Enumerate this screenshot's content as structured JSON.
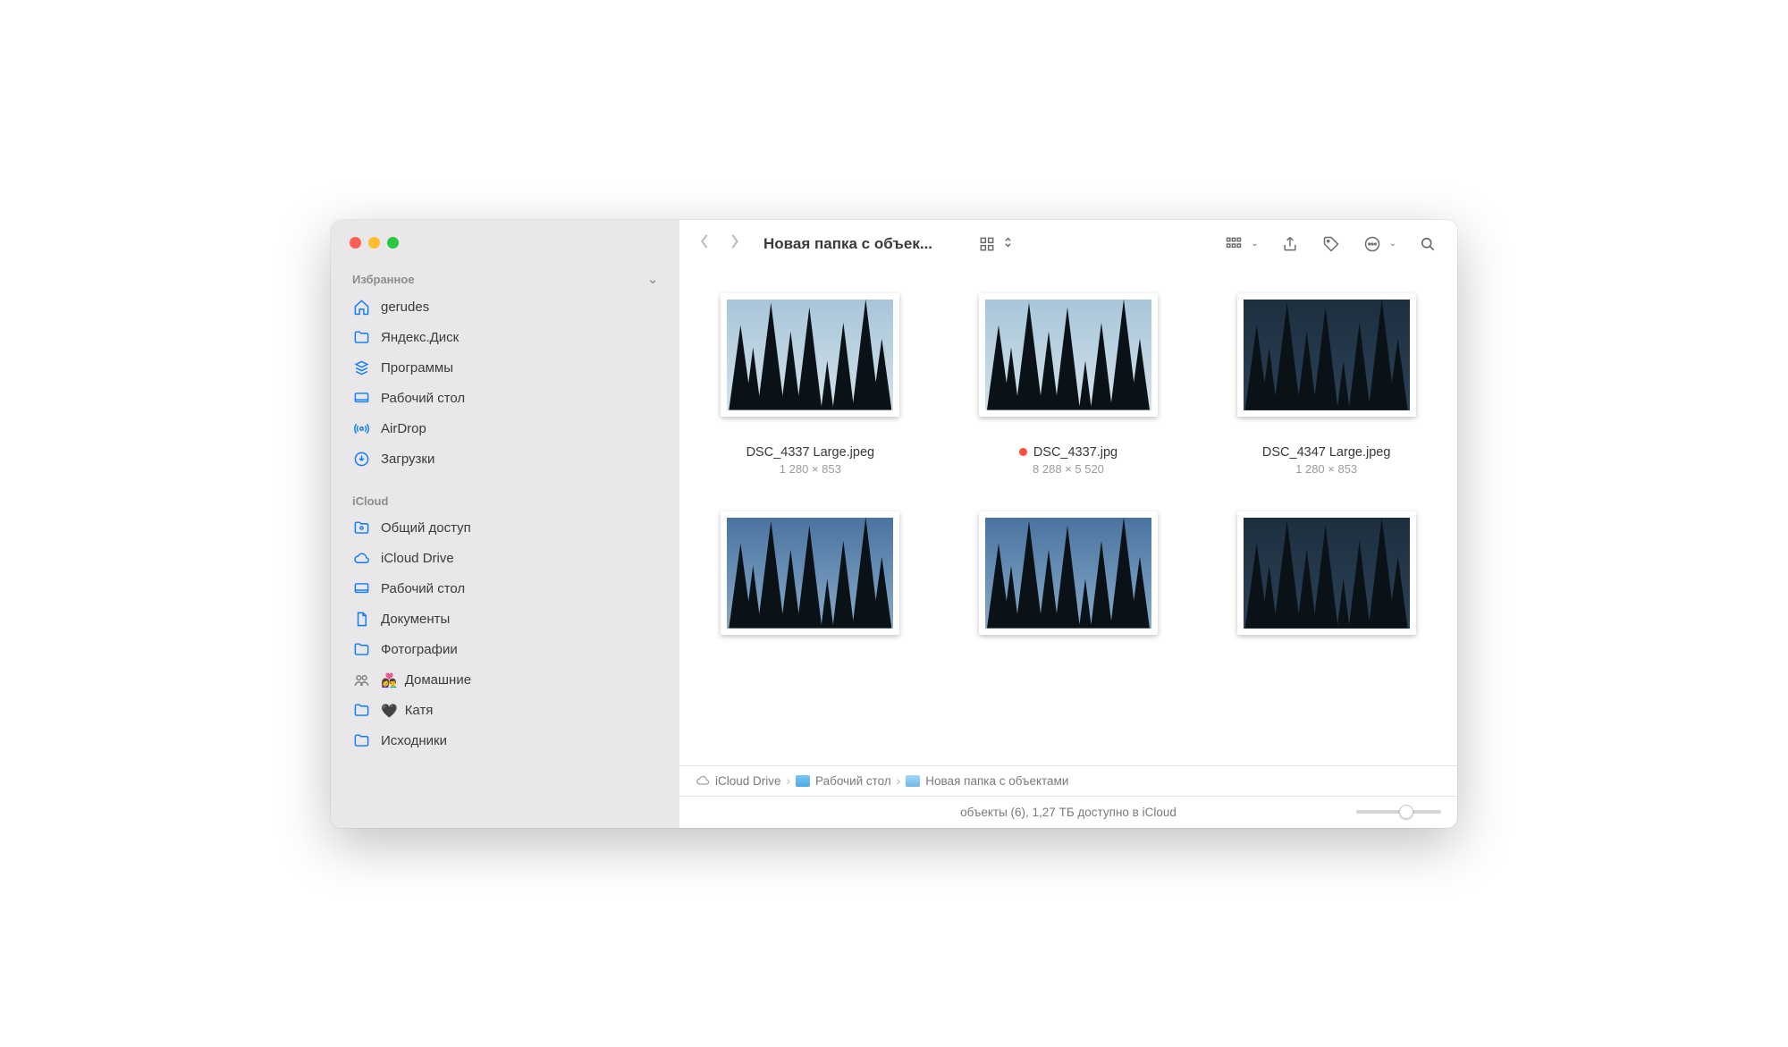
{
  "sidebar": {
    "section_favorites": "Избранное",
    "section_icloud": "iCloud",
    "favorites": [
      {
        "label": "gerudes",
        "icon": "home"
      },
      {
        "label": "Яндекс.Диск",
        "icon": "folder"
      },
      {
        "label": "Программы",
        "icon": "apps"
      },
      {
        "label": "Рабочий стол",
        "icon": "desktop"
      },
      {
        "label": "AirDrop",
        "icon": "airdrop"
      },
      {
        "label": "Загрузки",
        "icon": "download"
      }
    ],
    "icloud": [
      {
        "label": "Общий доступ",
        "icon": "shared"
      },
      {
        "label": "iCloud Drive",
        "icon": "cloud"
      },
      {
        "label": "Рабочий стол",
        "icon": "desktop"
      },
      {
        "label": "Документы",
        "icon": "doc"
      },
      {
        "label": "Фотографии",
        "icon": "folder"
      },
      {
        "label": "Домашние",
        "icon": "people",
        "emoji": "👩‍❤️‍👨"
      },
      {
        "label": "Катя",
        "icon": "folder",
        "emoji": "🖤"
      },
      {
        "label": "Исходники",
        "icon": "folder"
      }
    ]
  },
  "toolbar": {
    "title": "Новая папка с объек..."
  },
  "files": [
    {
      "name": "DSC_4337 Large.jpeg",
      "dims": "1 280 × 853",
      "tag": false,
      "sky": "a"
    },
    {
      "name": "DSC_4337.jpg",
      "dims": "8 288 × 5 520",
      "tag": true,
      "sky": "a"
    },
    {
      "name": "DSC_4347 Large.jpeg",
      "dims": "1 280 × 853",
      "tag": false,
      "sky": "c"
    },
    {
      "name": "",
      "dims": "",
      "tag": false,
      "sky": "b"
    },
    {
      "name": "",
      "dims": "",
      "tag": false,
      "sky": "b"
    },
    {
      "name": "",
      "dims": "",
      "tag": false,
      "sky": "c"
    }
  ],
  "path": {
    "p0": "iCloud Drive",
    "p1": "Рабочий стол",
    "p2": "Новая папка с объектами"
  },
  "status": "объекты (6), 1,27 ТБ доступно в iCloud"
}
